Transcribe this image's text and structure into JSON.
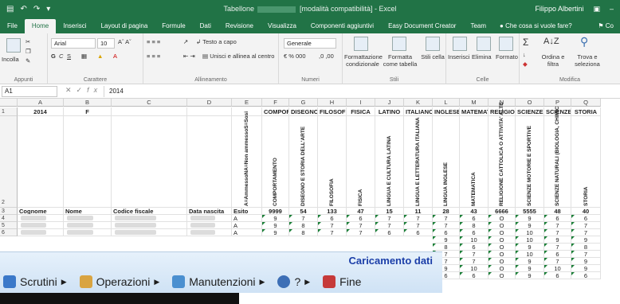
{
  "titlebar": {
    "title_prefix": "Tabellone",
    "title_suffix": "[modalità compatibilità] - Excel",
    "user": "Filippo Albertini"
  },
  "tabs": [
    "File",
    "Home",
    "Inserisci",
    "Layout di pagina",
    "Formule",
    "Dati",
    "Revisione",
    "Visualizza",
    "Componenti aggiuntivi",
    "Easy Document Creator",
    "Team"
  ],
  "tab_search": "Che cosa si vuole fare?",
  "tab_share": "Co",
  "ribbon": {
    "incolla": "Incolla",
    "appunti": "Appunti",
    "font_name": "Arial",
    "font_size": "10",
    "carattere": "Carattere",
    "testo_a_capo": "Testo a capo",
    "unisci": "Unisci e allinea al centro",
    "allineamento": "Allineamento",
    "number_format": "Generale",
    "numeri": "Numeri",
    "formattazione_condizionale": "Formattazione condizionale",
    "formatta_tabella": "Formatta come tabella",
    "stili_cella": "Stili cella",
    "stili": "Stili",
    "inserisci": "Inserisci",
    "elimina": "Elimina",
    "formato": "Formato",
    "celle": "Celle",
    "ordina": "Ordina e filtra",
    "trova": "Trova e seleziona",
    "modifica": "Modifica"
  },
  "formula_bar": {
    "namebox": "A1",
    "content": "2014"
  },
  "columns": [
    "A",
    "B",
    "C",
    "D",
    "E",
    "F",
    "G",
    "H",
    "I",
    "J",
    "K",
    "L",
    "M",
    "N",
    "O",
    "P",
    "Q"
  ],
  "rows": [
    "1",
    "2",
    "3",
    "4",
    "5",
    "6"
  ],
  "row1": {
    "A": "2014",
    "B": "F",
    "F": "COMPOR",
    "G": "DISEGNO",
    "H": "FILOSOFI",
    "I": "FISICA",
    "J": "LATINO",
    "K": "ITALIANO",
    "L": "INGLESE",
    "M": "MATEMAT",
    "N": "RELIGION",
    "O": "SCIENZE",
    "P": "SCIENZE",
    "Q": "STORIA"
  },
  "row2_vertical": {
    "E": "A=AmmessoNA=Non ammessoS=Sosi",
    "F": "COMPORTAMENTO",
    "G": "DISEGNO E STORIA DELL'ARTE",
    "H": "FILOSOFIA",
    "I": "FISICA",
    "J": "LINGUA E CULTURA LATINA",
    "K": "LINGUA E LETTERATURA ITALIANA",
    "L": "LINGUA INGLESE",
    "M": "MATEMATICA",
    "N": "RELIGIONE CATTOLICA O ATTIVITA' ALTE",
    "O": "SCIENZE MOTORIE E SPORTIVE",
    "P": "SCIENZE NATURALI (BIOLOGIA, CHIMIC",
    "Q": "STORIA"
  },
  "row3": {
    "A": "Cognome",
    "B": "Nome",
    "C": "Codice fiscale",
    "D": "Data nascita",
    "E": "Esito",
    "F": "9999",
    "G": "54",
    "H": "133",
    "I": "47",
    "J": "15",
    "K": "11",
    "L": "28",
    "M": "43",
    "N": "6666",
    "O": "5555",
    "P": "48",
    "Q": "40"
  },
  "data_rows": [
    {
      "E": "A",
      "F": "9",
      "G": "7",
      "H": "6",
      "I": "6",
      "J": "7",
      "K": "7",
      "L": "7",
      "M": "6",
      "N": "O",
      "O": "9",
      "P": "6",
      "Q": "6"
    },
    {
      "E": "A",
      "F": "9",
      "G": "8",
      "H": "7",
      "I": "7",
      "J": "7",
      "K": "7",
      "L": "7",
      "M": "8",
      "N": "O",
      "O": "9",
      "P": "7",
      "Q": "7"
    },
    {
      "E": "A",
      "F": "9",
      "G": "8",
      "H": "7",
      "I": "7",
      "J": "6",
      "K": "6",
      "L": "6",
      "M": "6",
      "N": "O",
      "O": "10",
      "P": "7",
      "Q": "7"
    }
  ],
  "extra_rows": [
    {
      "L": "9",
      "M": "10",
      "N": "O",
      "O": "10",
      "P": "9",
      "Q": "9"
    },
    {
      "L": "8",
      "M": "6",
      "N": "O",
      "O": "9",
      "P": "7",
      "Q": "8"
    },
    {
      "L": "7",
      "M": "7",
      "N": "O",
      "O": "10",
      "P": "6",
      "Q": "7"
    },
    {
      "L": "7",
      "M": "7",
      "N": "O",
      "O": "9",
      "P": "7",
      "Q": "9"
    },
    {
      "L": "9",
      "M": "10",
      "N": "O",
      "O": "9",
      "P": "10",
      "Q": "9"
    },
    {
      "L": "6",
      "M": "6",
      "N": "O",
      "O": "9",
      "P": "6",
      "Q": "6"
    }
  ],
  "overlay": {
    "title": "Caricamento dati",
    "menu": [
      {
        "label": "Scrutini",
        "icon": "scrutini-icon",
        "color": "#3a78c9"
      },
      {
        "label": "Operazioni",
        "icon": "operazioni-icon",
        "color": "#d9a441"
      },
      {
        "label": "Manutenzioni",
        "icon": "manutenzioni-icon",
        "color": "#4a8fd0"
      },
      {
        "label": "?",
        "icon": "help-icon",
        "color": "#3d6fb6"
      },
      {
        "label": "Fine",
        "icon": "fine-icon",
        "color": "#c63a3a"
      }
    ]
  },
  "colors": {
    "excel_green": "#217346",
    "overlay_title": "#1b3ea8"
  }
}
